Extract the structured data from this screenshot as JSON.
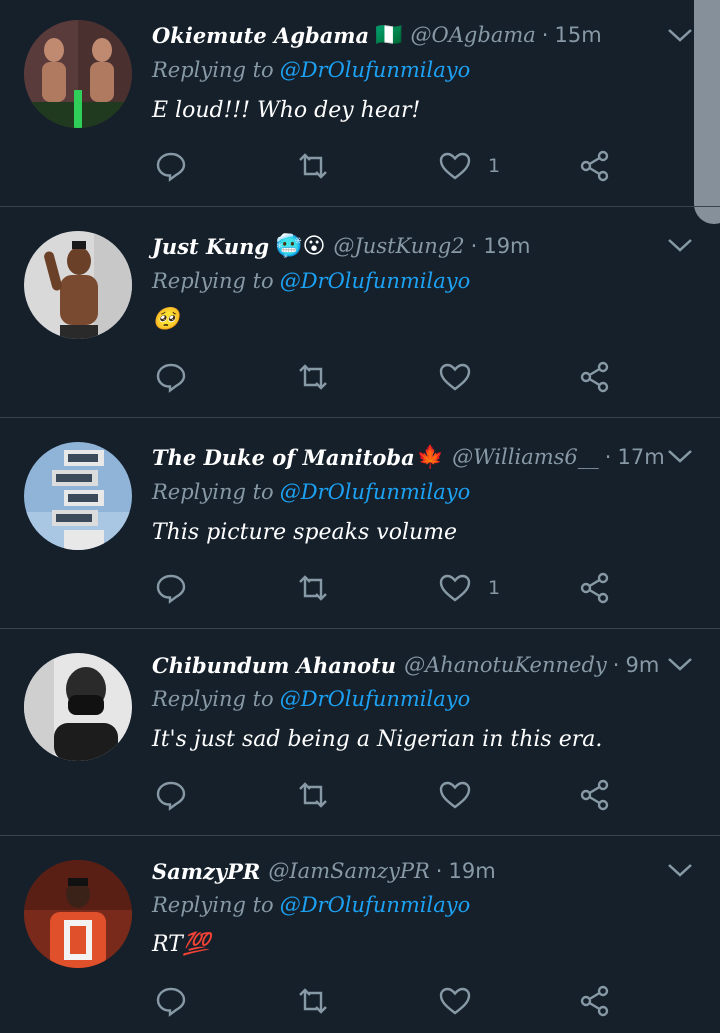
{
  "tweets": [
    {
      "name": "Okiemute Agbama",
      "name_emoji": "🇳🇬",
      "handle": "@OAgbama",
      "time": "15m",
      "replying_label": "Replying to",
      "replying_to": "@DrOlufunmilayo",
      "text": "E loud!!! Who dey hear!",
      "likes": "1"
    },
    {
      "name": "Just Kung",
      "name_emoji": "🥶😮",
      "handle": "@JustKung2",
      "time": "19m",
      "replying_label": "Replying to",
      "replying_to": "@DrOlufunmilayo",
      "text": "🥺",
      "likes": ""
    },
    {
      "name": "The Duke of Manitoba",
      "name_emoji": "🍁",
      "handle": "@Williams6__",
      "time": "17m",
      "replying_label": "Replying to",
      "replying_to": "@DrOlufunmilayo",
      "text": "This picture speaks volume",
      "likes": "1"
    },
    {
      "name": "Chibundum Ahanotu",
      "name_emoji": "",
      "handle": "@AhanotuKennedy",
      "time": "9m",
      "replying_label": "Replying to",
      "replying_to": "@DrOlufunmilayo",
      "text": "It's just sad being a Nigerian in this era.",
      "likes": ""
    },
    {
      "name": "SamzyPR",
      "name_emoji": "",
      "handle": "@IamSamzyPR",
      "time": "19m",
      "replying_label": "Replying to",
      "replying_to": "@DrOlufunmilayo",
      "text": "RT💯",
      "likes": ""
    }
  ],
  "separator": "·",
  "colors": {
    "background": "#15202b",
    "muted": "#8899a6",
    "link": "#1da1f2",
    "divider": "#38444d"
  },
  "icons": [
    "reply-icon",
    "retweet-icon",
    "like-icon",
    "share-icon",
    "chevron-down-icon"
  ]
}
